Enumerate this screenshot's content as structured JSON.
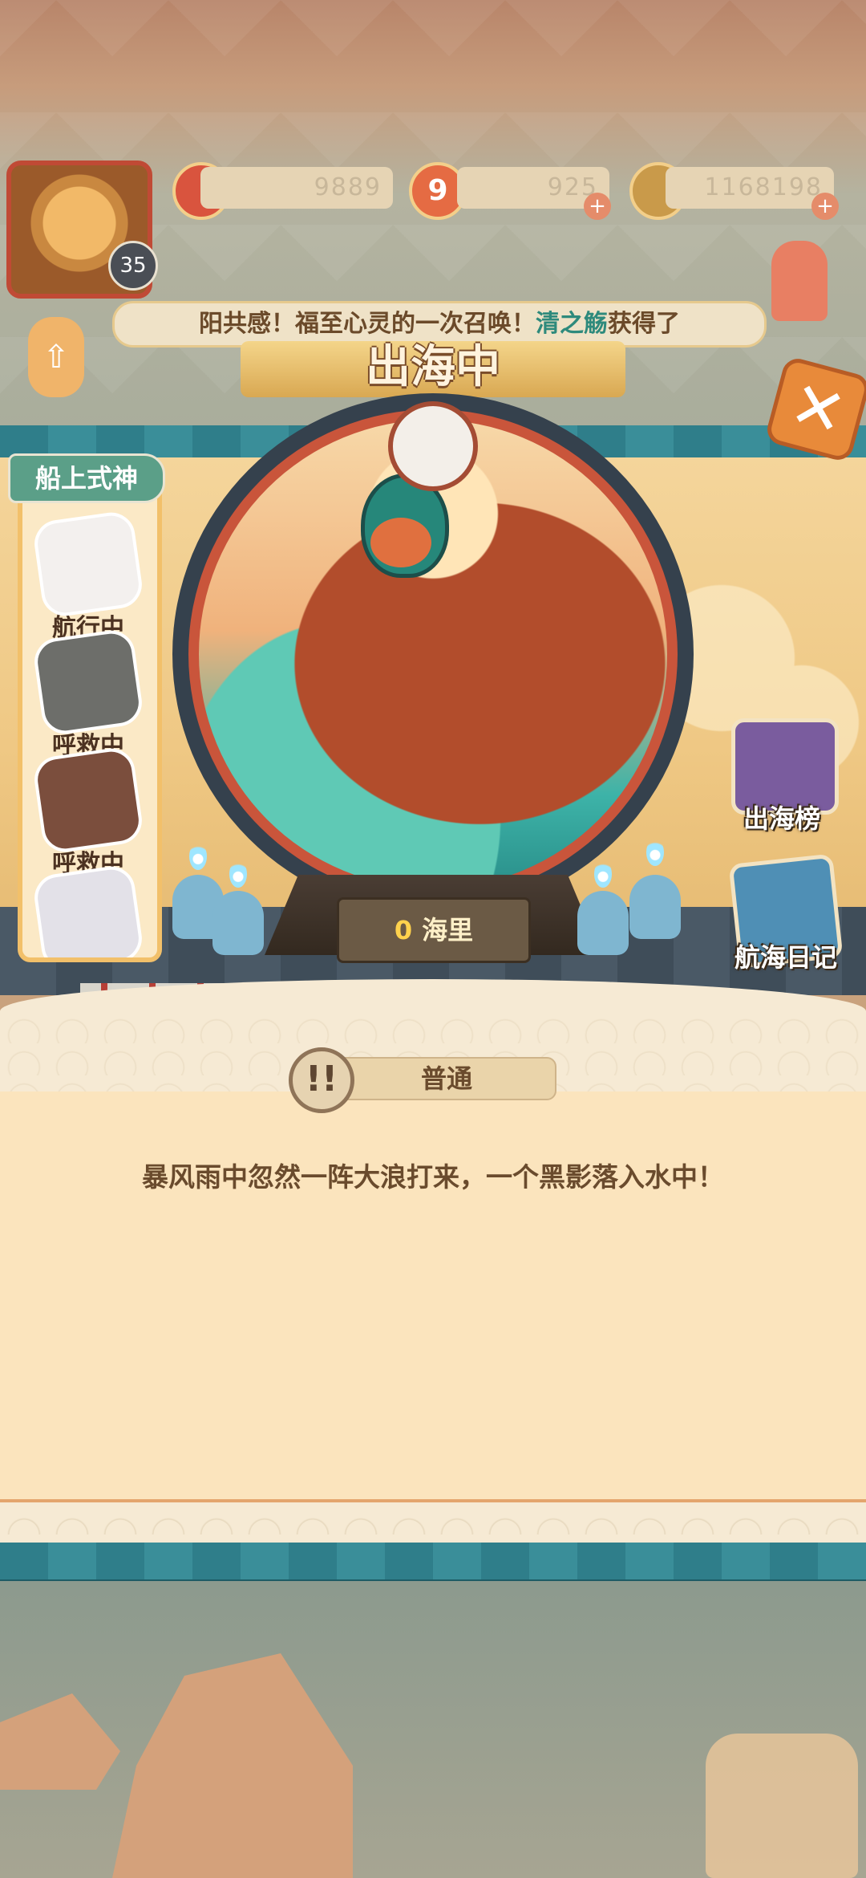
{
  "player": {
    "level": "35"
  },
  "resources": {
    "jade": "9889",
    "gouyu": "925",
    "coins": "1168198",
    "gouyu_icon_glyph": "9"
  },
  "notice": {
    "prefix": "阳共感！福至心灵的一次召唤！",
    "highlight": "清之觞",
    "suffix": "获得了"
  },
  "title": "出海中",
  "roster": {
    "title": "船上式神",
    "items": [
      {
        "status": "航行中",
        "color": "#f3f0ee"
      },
      {
        "status": "呼救中",
        "color": "#6d6e6a"
      },
      {
        "status": "呼救中",
        "color": "#7b4e3d"
      },
      {
        "status": "",
        "color": "#e3e1e8"
      }
    ]
  },
  "distance": {
    "value": "0",
    "unit": "海里"
  },
  "side_buttons": {
    "rank_label": "出海榜",
    "diary_label": "航海日记"
  },
  "event": {
    "badge": "普通",
    "badge_glyph": "!!",
    "text": "暴风雨中忽然一阵大浪打来，一个黑影落入水中！"
  },
  "icons": {
    "close": "✕",
    "lantern": "⇧",
    "plus": "+"
  },
  "colors": {
    "accent_teal": "#2e8a7c",
    "accent_red": "#c9553b",
    "panel": "#fbe4bd"
  }
}
